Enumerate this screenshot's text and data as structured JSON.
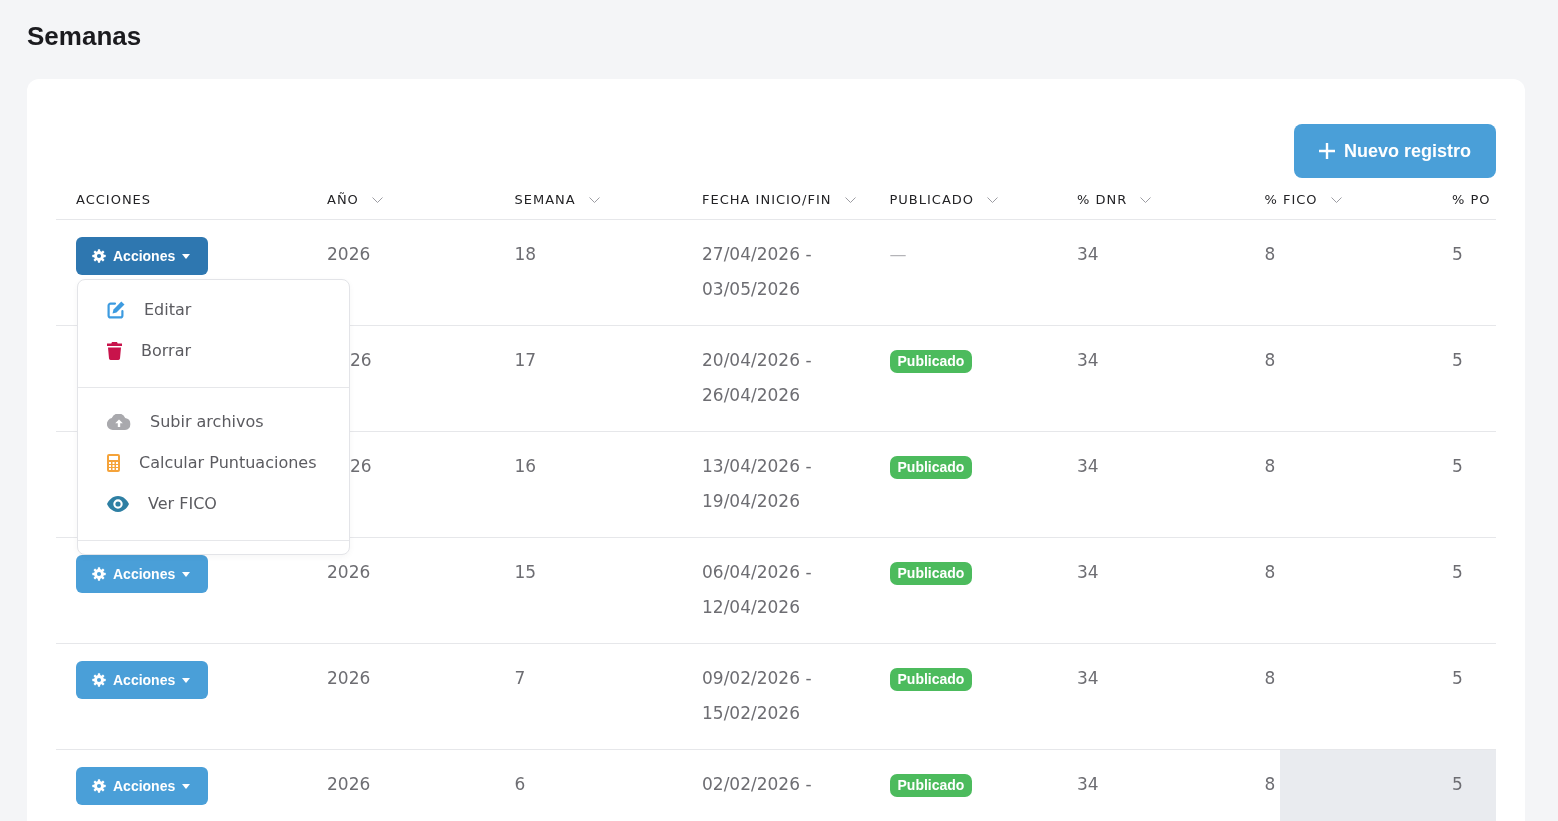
{
  "page": {
    "title": "Semanas"
  },
  "toolbar": {
    "new_button": {
      "label": "Nuevo registro"
    }
  },
  "table": {
    "columns": [
      {
        "label": "ACCIONES",
        "sortable": false
      },
      {
        "label": "AÑO",
        "sortable": true
      },
      {
        "label": "SEMANA",
        "sortable": true
      },
      {
        "label": "FECHA INICIO/FIN",
        "sortable": true
      },
      {
        "label": "PUBLICADO",
        "sortable": true
      },
      {
        "label": "% DNR",
        "sortable": true
      },
      {
        "label": "% FICO",
        "sortable": true
      },
      {
        "label": "% PO",
        "sortable": false
      }
    ],
    "rows": [
      {
        "actions": {
          "label": "Acciones",
          "expanded": true,
          "menu": {
            "sections": [
              {
                "items": [
                  {
                    "kind": "edit",
                    "label": "Editar"
                  },
                  {
                    "kind": "delete",
                    "label": "Borrar"
                  }
                ]
              },
              {
                "items": [
                  {
                    "kind": "upload",
                    "label": "Subir archivos"
                  },
                  {
                    "kind": "calculate",
                    "label": "Calcular Puntuaciones"
                  },
                  {
                    "kind": "view",
                    "label": "Ver FICO"
                  }
                ]
              }
            ]
          }
        },
        "under_menu": false,
        "year": "2026",
        "week": "18",
        "dates": "27/04/2026 - 03/05/2026",
        "published": {
          "published": false,
          "text": "—"
        },
        "dnr": "34",
        "fico": "8",
        "pod": "5",
        "pod_highlighted": false
      },
      {
        "under_menu": true,
        "year": "26",
        "week": "17",
        "dates": "20/04/2026 - 26/04/2026",
        "published": {
          "published": true,
          "text": "Publicado"
        },
        "dnr": "34",
        "fico": "8",
        "pod": "5",
        "pod_highlighted": false
      },
      {
        "under_menu": true,
        "year": "26",
        "week": "16",
        "dates": "13/04/2026 - 19/04/2026",
        "published": {
          "published": true,
          "text": "Publicado"
        },
        "dnr": "34",
        "fico": "8",
        "pod": "5",
        "pod_highlighted": false
      },
      {
        "actions": {
          "label": "Acciones",
          "expanded": false
        },
        "under_menu": false,
        "year": "2026",
        "week": "15",
        "dates": "06/04/2026 - 12/04/2026",
        "published": {
          "published": true,
          "text": "Publicado"
        },
        "dnr": "34",
        "fico": "8",
        "pod": "5",
        "pod_highlighted": false
      },
      {
        "actions": {
          "label": "Acciones",
          "expanded": false
        },
        "under_menu": false,
        "year": "2026",
        "week": "7",
        "dates": "09/02/2026 - 15/02/2026",
        "published": {
          "published": true,
          "text": "Publicado"
        },
        "dnr": "34",
        "fico": "8",
        "pod": "5",
        "pod_highlighted": false
      },
      {
        "actions": {
          "label": "Acciones",
          "expanded": false
        },
        "under_menu": false,
        "year": "2026",
        "week": "6",
        "dates": "02/02/2026 -",
        "published": {
          "published": true,
          "text": "Publicado"
        },
        "dnr": "34",
        "fico": "8",
        "pod": "5",
        "pod_highlighted": true
      }
    ]
  }
}
